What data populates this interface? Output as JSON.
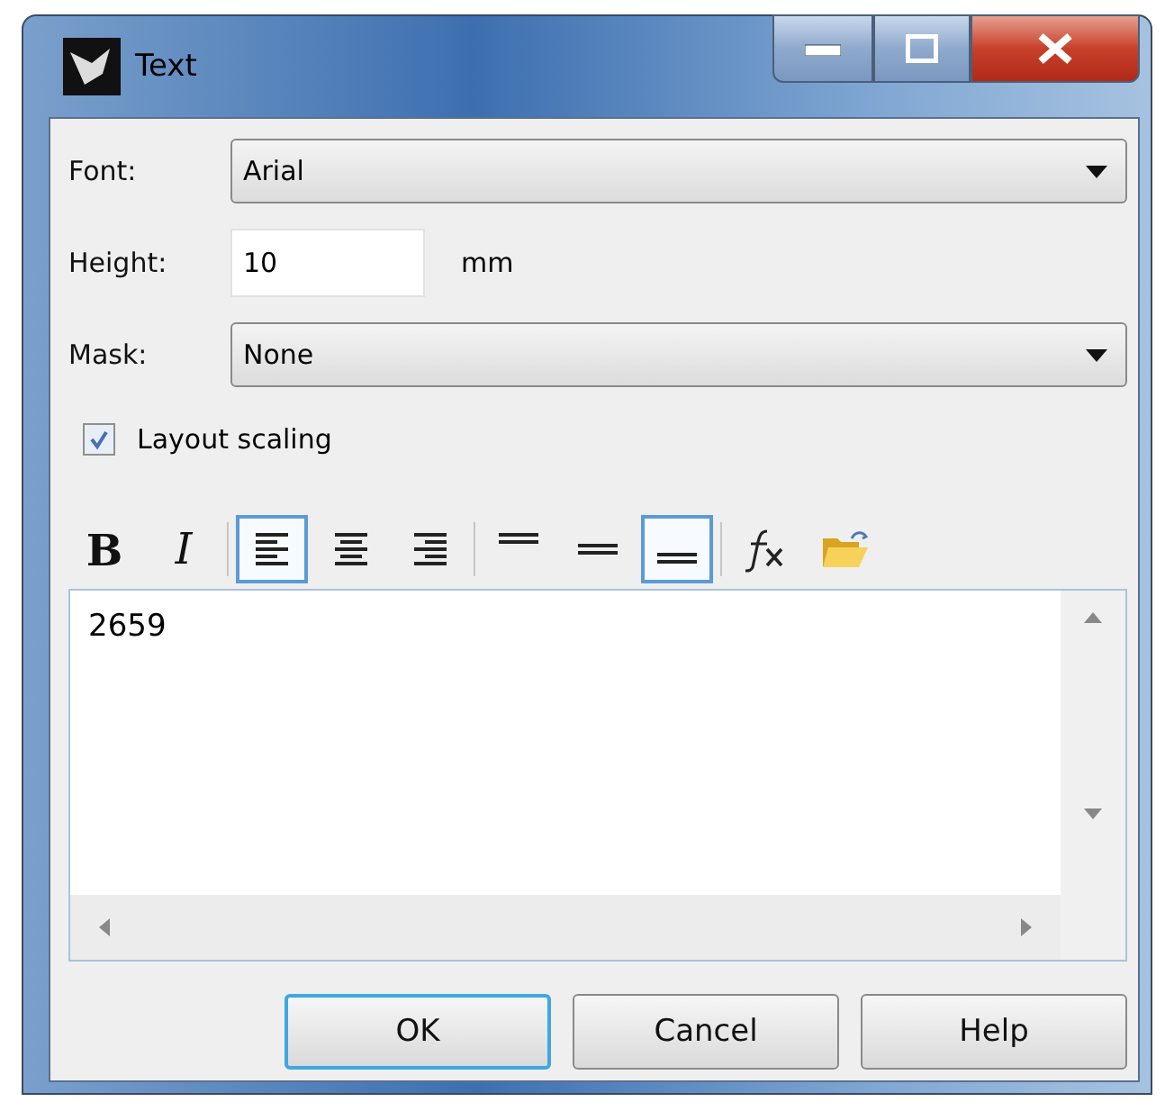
{
  "window": {
    "title": "Text"
  },
  "fields": [
    {
      "kind": "combo",
      "label": "Font:",
      "value": "Arial"
    },
    {
      "kind": "number",
      "label": "Height:",
      "value": "10",
      "unit": "mm"
    },
    {
      "kind": "combo",
      "label": "Mask:",
      "value": "None"
    }
  ],
  "layout_scaling": {
    "label": "Layout scaling",
    "checked": true
  },
  "toolbar": [
    {
      "kind": "bold",
      "label": "B",
      "selected": false
    },
    {
      "kind": "italic",
      "label": "I",
      "selected": false
    },
    {
      "kind": "separator"
    },
    {
      "kind": "align-left",
      "selected": true
    },
    {
      "kind": "align-center",
      "selected": false
    },
    {
      "kind": "align-right",
      "selected": false
    },
    {
      "kind": "separator"
    },
    {
      "kind": "valign-top",
      "selected": false
    },
    {
      "kind": "valign-middle",
      "selected": false
    },
    {
      "kind": "valign-bottom",
      "selected": true
    },
    {
      "kind": "separator"
    },
    {
      "kind": "function",
      "selected": false
    },
    {
      "kind": "open",
      "selected": false
    }
  ],
  "text_value": "2659",
  "buttons": [
    {
      "label": "OK",
      "default": true
    },
    {
      "label": "Cancel",
      "default": false
    },
    {
      "label": "Help",
      "default": false
    }
  ]
}
